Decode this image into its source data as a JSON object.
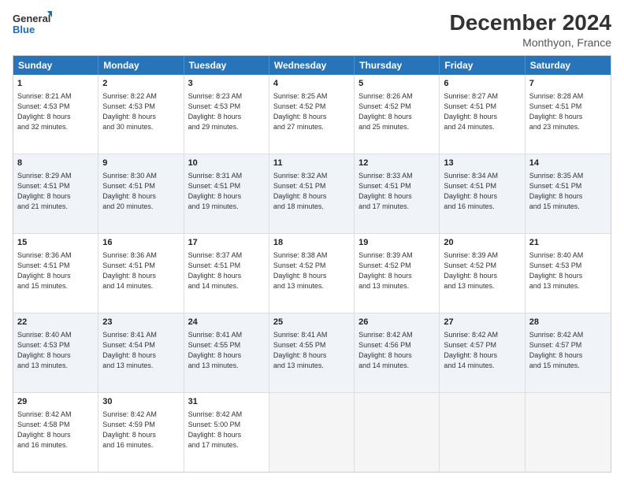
{
  "logo": {
    "line1": "General",
    "line2": "Blue"
  },
  "title": "December 2024",
  "subtitle": "Monthyon, France",
  "header_days": [
    "Sunday",
    "Monday",
    "Tuesday",
    "Wednesday",
    "Thursday",
    "Friday",
    "Saturday"
  ],
  "rows": [
    [
      {
        "day": "1",
        "text": "Sunrise: 8:21 AM\nSunset: 4:53 PM\nDaylight: 8 hours\nand 32 minutes."
      },
      {
        "day": "2",
        "text": "Sunrise: 8:22 AM\nSunset: 4:53 PM\nDaylight: 8 hours\nand 30 minutes."
      },
      {
        "day": "3",
        "text": "Sunrise: 8:23 AM\nSunset: 4:53 PM\nDaylight: 8 hours\nand 29 minutes."
      },
      {
        "day": "4",
        "text": "Sunrise: 8:25 AM\nSunset: 4:52 PM\nDaylight: 8 hours\nand 27 minutes."
      },
      {
        "day": "5",
        "text": "Sunrise: 8:26 AM\nSunset: 4:52 PM\nDaylight: 8 hours\nand 25 minutes."
      },
      {
        "day": "6",
        "text": "Sunrise: 8:27 AM\nSunset: 4:51 PM\nDaylight: 8 hours\nand 24 minutes."
      },
      {
        "day": "7",
        "text": "Sunrise: 8:28 AM\nSunset: 4:51 PM\nDaylight: 8 hours\nand 23 minutes."
      }
    ],
    [
      {
        "day": "8",
        "text": "Sunrise: 8:29 AM\nSunset: 4:51 PM\nDaylight: 8 hours\nand 21 minutes."
      },
      {
        "day": "9",
        "text": "Sunrise: 8:30 AM\nSunset: 4:51 PM\nDaylight: 8 hours\nand 20 minutes."
      },
      {
        "day": "10",
        "text": "Sunrise: 8:31 AM\nSunset: 4:51 PM\nDaylight: 8 hours\nand 19 minutes."
      },
      {
        "day": "11",
        "text": "Sunrise: 8:32 AM\nSunset: 4:51 PM\nDaylight: 8 hours\nand 18 minutes."
      },
      {
        "day": "12",
        "text": "Sunrise: 8:33 AM\nSunset: 4:51 PM\nDaylight: 8 hours\nand 17 minutes."
      },
      {
        "day": "13",
        "text": "Sunrise: 8:34 AM\nSunset: 4:51 PM\nDaylight: 8 hours\nand 16 minutes."
      },
      {
        "day": "14",
        "text": "Sunrise: 8:35 AM\nSunset: 4:51 PM\nDaylight: 8 hours\nand 15 minutes."
      }
    ],
    [
      {
        "day": "15",
        "text": "Sunrise: 8:36 AM\nSunset: 4:51 PM\nDaylight: 8 hours\nand 15 minutes."
      },
      {
        "day": "16",
        "text": "Sunrise: 8:36 AM\nSunset: 4:51 PM\nDaylight: 8 hours\nand 14 minutes."
      },
      {
        "day": "17",
        "text": "Sunrise: 8:37 AM\nSunset: 4:51 PM\nDaylight: 8 hours\nand 14 minutes."
      },
      {
        "day": "18",
        "text": "Sunrise: 8:38 AM\nSunset: 4:52 PM\nDaylight: 8 hours\nand 13 minutes."
      },
      {
        "day": "19",
        "text": "Sunrise: 8:39 AM\nSunset: 4:52 PM\nDaylight: 8 hours\nand 13 minutes."
      },
      {
        "day": "20",
        "text": "Sunrise: 8:39 AM\nSunset: 4:52 PM\nDaylight: 8 hours\nand 13 minutes."
      },
      {
        "day": "21",
        "text": "Sunrise: 8:40 AM\nSunset: 4:53 PM\nDaylight: 8 hours\nand 13 minutes."
      }
    ],
    [
      {
        "day": "22",
        "text": "Sunrise: 8:40 AM\nSunset: 4:53 PM\nDaylight: 8 hours\nand 13 minutes."
      },
      {
        "day": "23",
        "text": "Sunrise: 8:41 AM\nSunset: 4:54 PM\nDaylight: 8 hours\nand 13 minutes."
      },
      {
        "day": "24",
        "text": "Sunrise: 8:41 AM\nSunset: 4:55 PM\nDaylight: 8 hours\nand 13 minutes."
      },
      {
        "day": "25",
        "text": "Sunrise: 8:41 AM\nSunset: 4:55 PM\nDaylight: 8 hours\nand 13 minutes."
      },
      {
        "day": "26",
        "text": "Sunrise: 8:42 AM\nSunset: 4:56 PM\nDaylight: 8 hours\nand 14 minutes."
      },
      {
        "day": "27",
        "text": "Sunrise: 8:42 AM\nSunset: 4:57 PM\nDaylight: 8 hours\nand 14 minutes."
      },
      {
        "day": "28",
        "text": "Sunrise: 8:42 AM\nSunset: 4:57 PM\nDaylight: 8 hours\nand 15 minutes."
      }
    ],
    [
      {
        "day": "29",
        "text": "Sunrise: 8:42 AM\nSunset: 4:58 PM\nDaylight: 8 hours\nand 16 minutes."
      },
      {
        "day": "30",
        "text": "Sunrise: 8:42 AM\nSunset: 4:59 PM\nDaylight: 8 hours\nand 16 minutes."
      },
      {
        "day": "31",
        "text": "Sunrise: 8:42 AM\nSunset: 5:00 PM\nDaylight: 8 hours\nand 17 minutes."
      },
      {
        "day": "",
        "text": ""
      },
      {
        "day": "",
        "text": ""
      },
      {
        "day": "",
        "text": ""
      },
      {
        "day": "",
        "text": ""
      }
    ]
  ]
}
